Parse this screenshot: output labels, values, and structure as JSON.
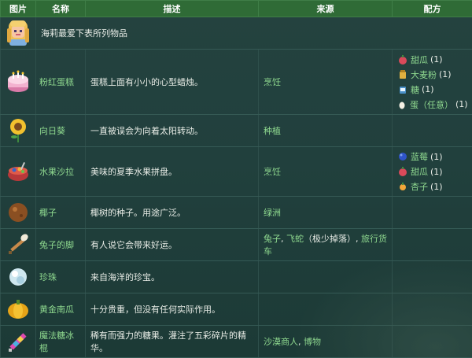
{
  "header": {
    "col_image": "图片",
    "col_name": "名称",
    "col_desc": "描述",
    "col_source": "来源",
    "col_recipe": "配方"
  },
  "intro": {
    "text": "海莉最爱下表所列物品"
  },
  "rows": [
    {
      "icon": "pink-cake-icon",
      "name": "粉红蛋糕",
      "desc": "蛋糕上面有小小的心型蜡烛。",
      "source": "烹饪",
      "recipe": [
        {
          "icon": "melon-icon",
          "name": "甜瓜",
          "count": "(1)"
        },
        {
          "icon": "wheat-flour-icon",
          "name": "大麦粉",
          "count": "(1)"
        },
        {
          "icon": "sugar-icon",
          "name": "糖",
          "count": "(1)"
        },
        {
          "icon": "egg-icon",
          "name": "蛋（任意）",
          "count": "(1)"
        }
      ]
    },
    {
      "icon": "sunflower-icon",
      "name": "向日葵",
      "desc": "一直被误会为向着太阳转动。",
      "source": "种植",
      "recipe": []
    },
    {
      "icon": "fruit-salad-icon",
      "name": "水果沙拉",
      "desc": "美味的夏季水果拼盘。",
      "source": "烹饪",
      "recipe": [
        {
          "icon": "blueberry-icon",
          "name": "蓝莓",
          "count": "(1)"
        },
        {
          "icon": "melon-icon",
          "name": "甜瓜",
          "count": "(1)"
        },
        {
          "icon": "apricot-icon",
          "name": "杏子",
          "count": "(1)"
        }
      ]
    },
    {
      "icon": "coconut-icon",
      "name": "椰子",
      "desc": "椰树的种子。用途广泛。",
      "source": "绿洲",
      "recipe": []
    },
    {
      "icon": "rabbit-foot-icon",
      "name": "兔子的脚",
      "desc": "有人说它会带来好运。",
      "source_parts": [
        {
          "text": "兔子",
          "link": true
        },
        {
          "text": ", ",
          "link": false
        },
        {
          "text": "飞蛇",
          "link": true
        },
        {
          "text": "（极少掉落）, ",
          "link": false
        },
        {
          "text": "旅行货车",
          "link": true
        }
      ],
      "recipe": []
    },
    {
      "icon": "pearl-icon",
      "name": "珍珠",
      "desc": "来自海洋的珍宝。",
      "source": "",
      "recipe": []
    },
    {
      "icon": "golden-pumpkin-icon",
      "name": "黄金南瓜",
      "desc": "十分贵重，但没有任何实际作用。",
      "source": "",
      "recipe": []
    },
    {
      "icon": "magic-rock-candy-icon",
      "name": "魔法糖冰棍",
      "desc": "稀有而强力的糖果。灌注了五彩碎片的精华。",
      "source_parts": [
        {
          "text": "沙漠商人",
          "link": true
        },
        {
          "text": ", ",
          "link": false
        },
        {
          "text": "博物",
          "link": true
        }
      ],
      "recipe": []
    }
  ],
  "colors": {
    "header_bg": "#2f6b36",
    "link": "#8fd98f",
    "text": "#e8ece6",
    "row_bg": "#21403d"
  }
}
